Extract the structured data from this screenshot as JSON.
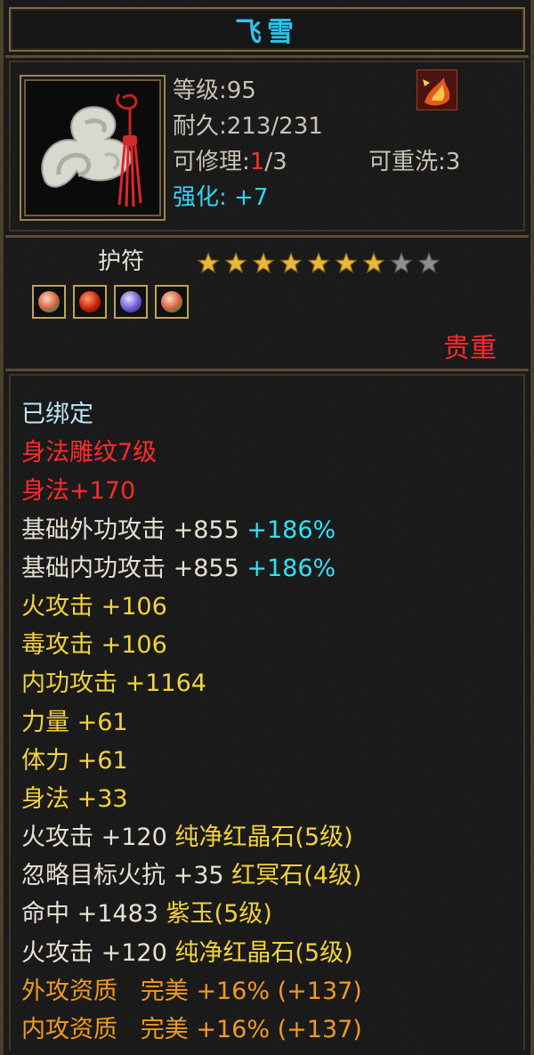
{
  "title": "飞雪",
  "item": {
    "icon": "jade-amulet-icon",
    "badge_icon": "fire-phoenix-icon",
    "level_label": "等级:",
    "level": "95",
    "durability_label": "耐久:",
    "durability": "213/231",
    "repair_label": "可修理:",
    "repair_used": "1",
    "repair_total": "/3",
    "rewash_label": "可重洗:",
    "rewash": "3",
    "enhance_label": "强化:",
    "enhance": "+7"
  },
  "type": {
    "label": "护符",
    "stars_total": 9,
    "stars_filled": 7,
    "rarity": "贵重",
    "gems": [
      "green-gem-icon",
      "red-gem-icon",
      "purple-gem-icon",
      "green-gem-icon"
    ]
  },
  "attributes": {
    "bound": "已绑定",
    "engrave": "身法雕纹7级",
    "agility_bonus": "身法+170",
    "ext_attack": {
      "label": "基础外功攻击",
      "value": "+855",
      "pct": "+186%"
    },
    "int_attack": {
      "label": "基础内功攻击",
      "value": "+855",
      "pct": "+186%"
    },
    "fire": {
      "label": "火攻击",
      "value": "+106"
    },
    "poison": {
      "label": "毒攻击",
      "value": "+106"
    },
    "inner": {
      "label": "内功攻击",
      "value": "+1164"
    },
    "strength": {
      "label": "力量",
      "value": "+61"
    },
    "stamina": {
      "label": "体力",
      "value": "+61"
    },
    "agility": {
      "label": "身法",
      "value": "+33"
    },
    "socket1": {
      "label": "火攻击",
      "value": "+120",
      "gem": "纯净红晶石(5级)"
    },
    "socket2": {
      "label": "忽略目标火抗",
      "value": "+35",
      "gem": "红冥石(4级)"
    },
    "socket3": {
      "label": "命中",
      "value": "+1483",
      "gem": "紫玉(5级)"
    },
    "socket4": {
      "label": "火攻击",
      "value": "+120",
      "gem": "纯净红晶石(5级)"
    },
    "apt_ext": {
      "label": "外攻资质",
      "grade": "完美",
      "value": "+16%",
      "extra": "(+137)"
    },
    "apt_int": {
      "label": "内攻资质",
      "grade": "完美",
      "value": "+16%",
      "extra": "(+137)"
    }
  },
  "colors": {
    "title": "#2fc3ee",
    "enhance": "#34d4f2",
    "rarity": "#ff2a2a",
    "base_attr": "#f3d23a",
    "aptitude": "#f09a20",
    "border": "#7c6a44"
  }
}
